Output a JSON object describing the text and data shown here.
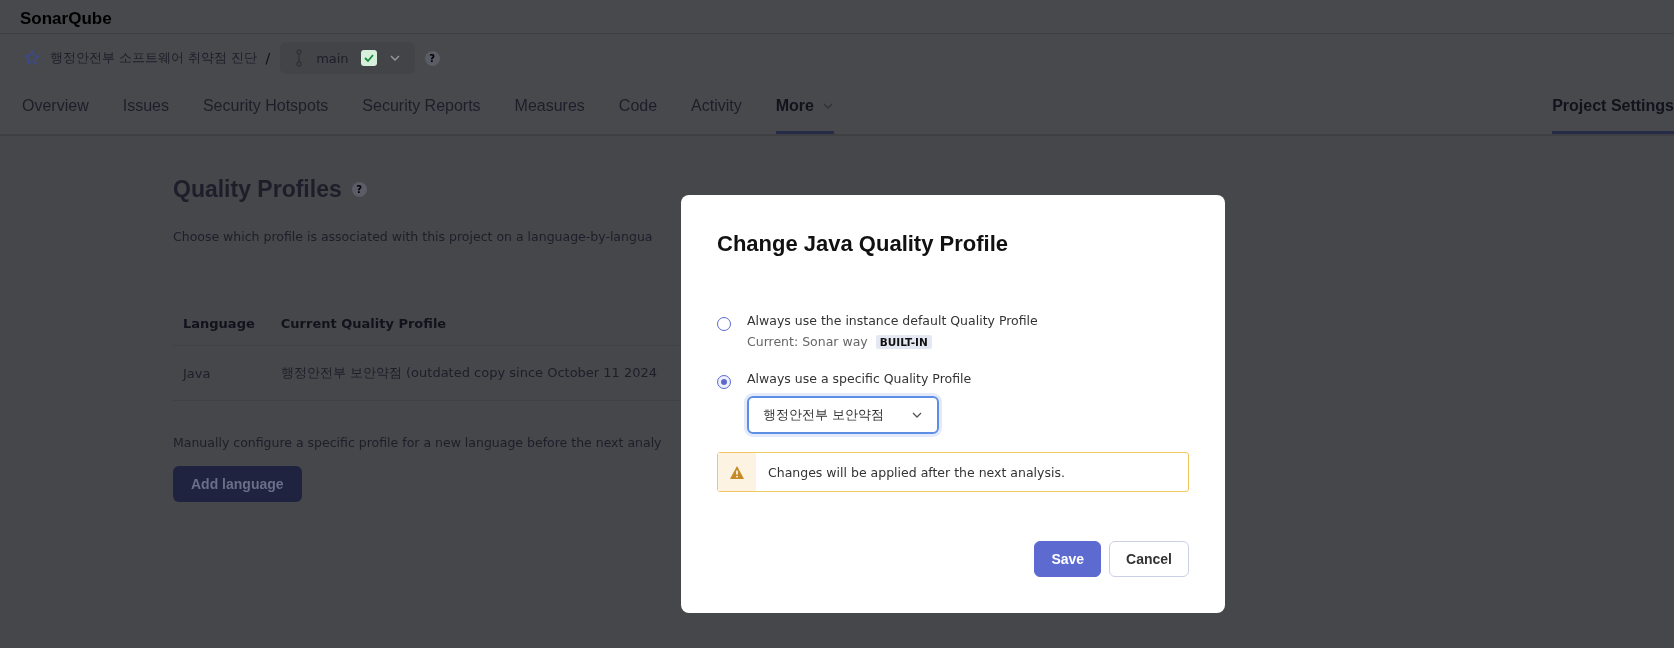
{
  "app": {
    "name": "SonarQube"
  },
  "breadcrumb": {
    "project": "행정안전부 소프트웨어 취약점 진단",
    "separator": "/",
    "branch": "main",
    "help": "?"
  },
  "nav": {
    "tabs": [
      {
        "label": "Overview",
        "selected": false
      },
      {
        "label": "Issues",
        "selected": false
      },
      {
        "label": "Security Hotspots",
        "selected": false
      },
      {
        "label": "Security Reports",
        "selected": false
      },
      {
        "label": "Measures",
        "selected": false
      },
      {
        "label": "Code",
        "selected": false
      },
      {
        "label": "Activity",
        "selected": false
      },
      {
        "label": "More",
        "selected": true,
        "dropdown": true
      }
    ],
    "settings": {
      "label": "Project Settings",
      "selected": true
    }
  },
  "page": {
    "title": "Quality Profiles",
    "help": "?",
    "description": "Choose which profile is associated with this project on a language-by-langua",
    "table": {
      "columns": [
        "Language",
        "Current Quality Profile"
      ],
      "rows": [
        [
          "Java",
          "행정안전부 보안약점 (outdated copy since October 11 2024"
        ]
      ]
    },
    "manual_note": "Manually configure a specific profile for a new language before the next analy",
    "add_button": "Add language"
  },
  "modal": {
    "title": "Change Java Quality Profile",
    "options": [
      {
        "label": "Always use the instance default Quality Profile",
        "sub": "Current: Sonar way",
        "badge": "BUILT-IN",
        "selected": false
      },
      {
        "label": "Always use a specific Quality Profile",
        "select": "행정안전부 보안약점",
        "selected": true
      }
    ],
    "warning": "Changes will be applied after the next analysis.",
    "buttons": [
      {
        "label": "Save",
        "kind": "primary"
      },
      {
        "label": "Cancel",
        "kind": "secondary"
      }
    ]
  }
}
